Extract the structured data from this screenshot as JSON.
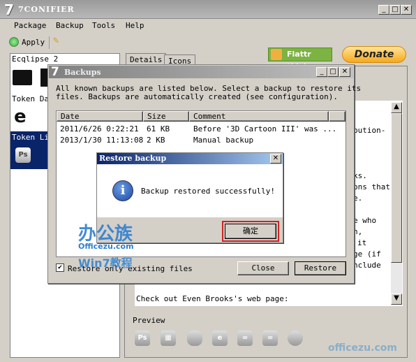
{
  "window": {
    "title": "7CONIFIER",
    "logo": "7"
  },
  "menu": [
    "Package",
    "Backup",
    "Tools",
    "Help"
  ],
  "toolbar": {
    "apply": "Apply"
  },
  "packages": {
    "selected": "Ecqlipse 2",
    "items": [
      "Token Dar",
      "Token Lig"
    ]
  },
  "tabs": [
    "Details",
    "Icons"
  ],
  "buttons": {
    "flattr": "Flattr this!",
    "donate": "Donate"
  },
  "details_text": [
    "bution-",
    "ks.",
    "ons that",
    "e.",
    "e who",
    "n,",
    "it",
    "ge (if",
    "nclude",
    "Check out Even Brooks's web page:"
  ],
  "preview": {
    "label": "Preview"
  },
  "backups": {
    "title": "Backups",
    "logo": "7",
    "description1": "All known backups are listed below. Select a backup to restore its",
    "description2": "files. Backups are automatically created (see configuration).",
    "columns": [
      "Date",
      "Size",
      "Comment"
    ],
    "rows": [
      {
        "date": "2011/6/26 0:22:21",
        "size": "61 KB",
        "comment": "Before '3D Cartoon III' was ..."
      },
      {
        "date": "2013/1/30 11:13:08",
        "size": "2 KB",
        "comment": "Manual backup"
      }
    ],
    "checkbox_label": "Restore only existing files",
    "checkbox_checked": true,
    "close": "Close",
    "restore": "Restore"
  },
  "restore_dialog": {
    "title": "Restore backup",
    "message": "Backup restored successfully!",
    "ok": "确定"
  },
  "watermark": {
    "line1": "办公族",
    "line2": "Officezu.com",
    "line3": "Win7教程",
    "corner": "officezu.com"
  }
}
